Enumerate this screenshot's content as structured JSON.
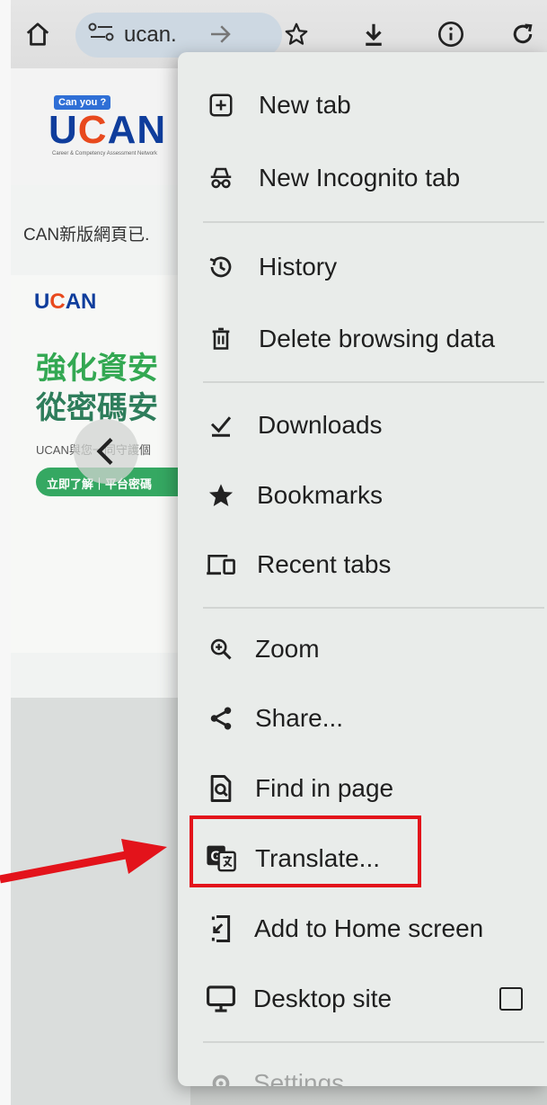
{
  "toolbar": {
    "url_text": "ucan.",
    "icons": [
      "home-icon",
      "site-settings-icon",
      "forward-icon",
      "bookmark-star-icon",
      "download-icon",
      "info-icon",
      "reload-icon"
    ]
  },
  "page": {
    "logo_badge": "Can you ?",
    "logo_text_1": "U",
    "logo_text_2": "C",
    "logo_text_3": "AN",
    "logo_subtitle": "Career & Competency Assessment Network",
    "news_text": "CAN新版網頁已.",
    "banner_logo_1": "U",
    "banner_logo_2": "C",
    "banner_logo_3": "AN",
    "banner_title_1": "強化資安",
    "banner_title_2": "從密碼安",
    "banner_sub": "UCAN與您一同守護個",
    "banner_button": "立即了解｜平台密碼"
  },
  "menu": {
    "items": [
      {
        "label": "New tab",
        "icon": "new-tab-icon"
      },
      {
        "label": "New Incognito tab",
        "icon": "incognito-icon"
      },
      {
        "label": "History",
        "icon": "history-icon"
      },
      {
        "label": "Delete browsing data",
        "icon": "trash-icon"
      },
      {
        "label": "Downloads",
        "icon": "downloads-icon"
      },
      {
        "label": "Bookmarks",
        "icon": "star-icon"
      },
      {
        "label": "Recent tabs",
        "icon": "devices-icon"
      },
      {
        "label": "Zoom",
        "icon": "zoom-icon"
      },
      {
        "label": "Share...",
        "icon": "share-icon"
      },
      {
        "label": "Find in page",
        "icon": "find-icon"
      },
      {
        "label": "Translate...",
        "icon": "translate-icon"
      },
      {
        "label": "Add to Home screen",
        "icon": "add-to-home-icon"
      },
      {
        "label": "Desktop site",
        "icon": "desktop-icon",
        "checked": false
      },
      {
        "label": "Settings",
        "icon": "gear-icon"
      }
    ]
  },
  "colors": {
    "highlight": "#e3131b",
    "url_pill": "#cdd8e2",
    "menu_bg": "#e9ecea"
  }
}
